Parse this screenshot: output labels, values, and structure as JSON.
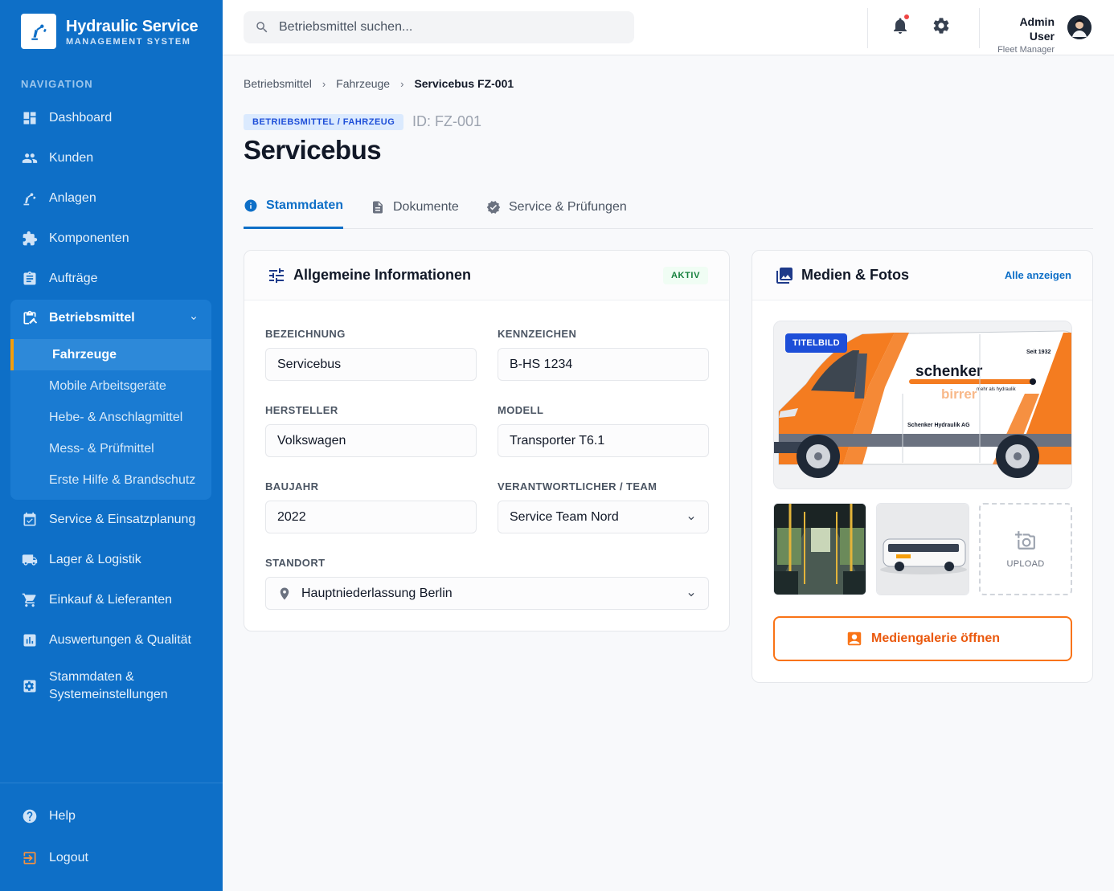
{
  "app": {
    "title": "Hydraulic Service",
    "subtitle": "MANAGEMENT SYSTEM"
  },
  "sidebar": {
    "heading": "NAVIGATION",
    "items": [
      {
        "label": "Dashboard",
        "icon": "dashboard-icon"
      },
      {
        "label": "Kunden",
        "icon": "people-icon"
      },
      {
        "label": "Anlagen",
        "icon": "robot-arm-icon"
      },
      {
        "label": "Komponenten",
        "icon": "puzzle-icon"
      },
      {
        "label": "Aufträge",
        "icon": "clipboard-icon"
      }
    ],
    "group": {
      "label": "Betriebsmittel",
      "icon": "equipment-icon",
      "expanded": true,
      "subitems": [
        {
          "label": "Fahrzeuge",
          "active": true
        },
        {
          "label": "Mobile Arbeitsgeräte"
        },
        {
          "label": "Hebe- & Anschlagmittel"
        },
        {
          "label": "Mess- & Prüfmittel"
        },
        {
          "label": "Erste Hilfe & Brandschutz"
        }
      ]
    },
    "items_after": [
      {
        "label": "Service & Einsatzplanung",
        "icon": "calendar-check-icon"
      },
      {
        "label": "Lager & Logistik",
        "icon": "truck-icon"
      },
      {
        "label": "Einkauf & Lieferanten",
        "icon": "cart-icon"
      },
      {
        "label": "Auswertungen & Qualität",
        "icon": "chart-icon"
      },
      {
        "label": "Stammdaten & Systemeinstellungen",
        "icon": "settings-box-icon"
      }
    ],
    "footer": [
      {
        "label": "Help",
        "icon": "help-icon"
      },
      {
        "label": "Logout",
        "icon": "logout-icon"
      }
    ]
  },
  "topbar": {
    "search_placeholder": "Betriebsmittel suchen...",
    "user_name": "Admin User",
    "user_role": "Fleet Manager"
  },
  "breadcrumb": [
    "Betriebsmittel",
    "Fahrzeuge",
    "Servicebus FZ-001"
  ],
  "header": {
    "type_badge": "BETRIEBSMITTEL / FAHRZEUG",
    "id": "ID: FZ-001",
    "title": "Servicebus"
  },
  "tabs": [
    {
      "label": "Stammdaten",
      "active": true
    },
    {
      "label": "Dokumente"
    },
    {
      "label": "Service & Prüfungen"
    }
  ],
  "info_card": {
    "title": "Allgemeine Informationen",
    "status": "AKTIV",
    "fields": {
      "bezeichnung": {
        "label": "BEZEICHNUNG",
        "value": "Servicebus"
      },
      "kennzeichen": {
        "label": "KENNZEICHEN",
        "value": "B-HS 1234"
      },
      "hersteller": {
        "label": "HERSTELLER",
        "value": "Volkswagen"
      },
      "modell": {
        "label": "MODELL",
        "value": "Transporter T6.1"
      },
      "baujahr": {
        "label": "BAUJAHR",
        "value": "2022"
      },
      "team": {
        "label": "VERANTWORTLICHER / TEAM",
        "value": "Service Team Nord"
      },
      "standort": {
        "label": "STANDORT",
        "value": "Hauptniederlassung Berlin"
      }
    }
  },
  "media_card": {
    "title": "Medien & Fotos",
    "link": "Alle anzeigen",
    "primary_badge": "TITELBILD",
    "van_brand": "schenker",
    "van_brand2": "birrer",
    "van_tagline": "mehr als hydraulik",
    "van_since": "Seit 1932",
    "van_company": "Schenker Hydraulik AG",
    "upload_label": "UPLOAD",
    "gallery_button": "Mediengalerie öffnen"
  },
  "colors": {
    "sidebar": "#0e6fc7",
    "accent": "#0e6fc7",
    "orange": "#f97316",
    "status_green": "#15803d"
  }
}
